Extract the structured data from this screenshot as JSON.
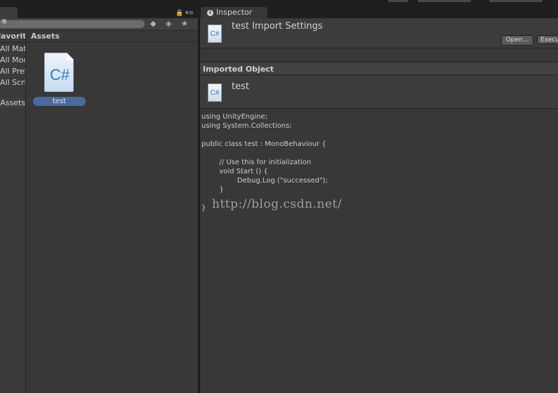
{
  "project": {
    "favorites_header": "Favorites",
    "favorites": [
      "All Materials",
      "All Models",
      "All Prefabs",
      "All Scripts"
    ],
    "selected_folder": "Assets",
    "assets_header": "Assets",
    "items": [
      {
        "name": "test",
        "icon": "csharp-file-icon",
        "glyph": "C#"
      }
    ]
  },
  "inspector": {
    "tab_label": "Inspector",
    "title": "test Import Settings",
    "open_button": "Open...",
    "execute_button": "Execute Order...",
    "imported_object_header": "Imported Object",
    "object_name": "test",
    "file_glyph": "C#",
    "code": "using UnityEngine;\nusing System.Collections;\n\npublic class test : MonoBehaviour {\n\n\t// Use this for initialization\n\tvoid Start () {\n\t\tDebug.Log (\"successed\");\n\t}\n\n}",
    "watermark": "http://blog.csdn.net/"
  },
  "colors": {
    "selection": "#4b6a9a",
    "panel_bg": "#383838",
    "csharp_blue": "#2f7cc4"
  }
}
